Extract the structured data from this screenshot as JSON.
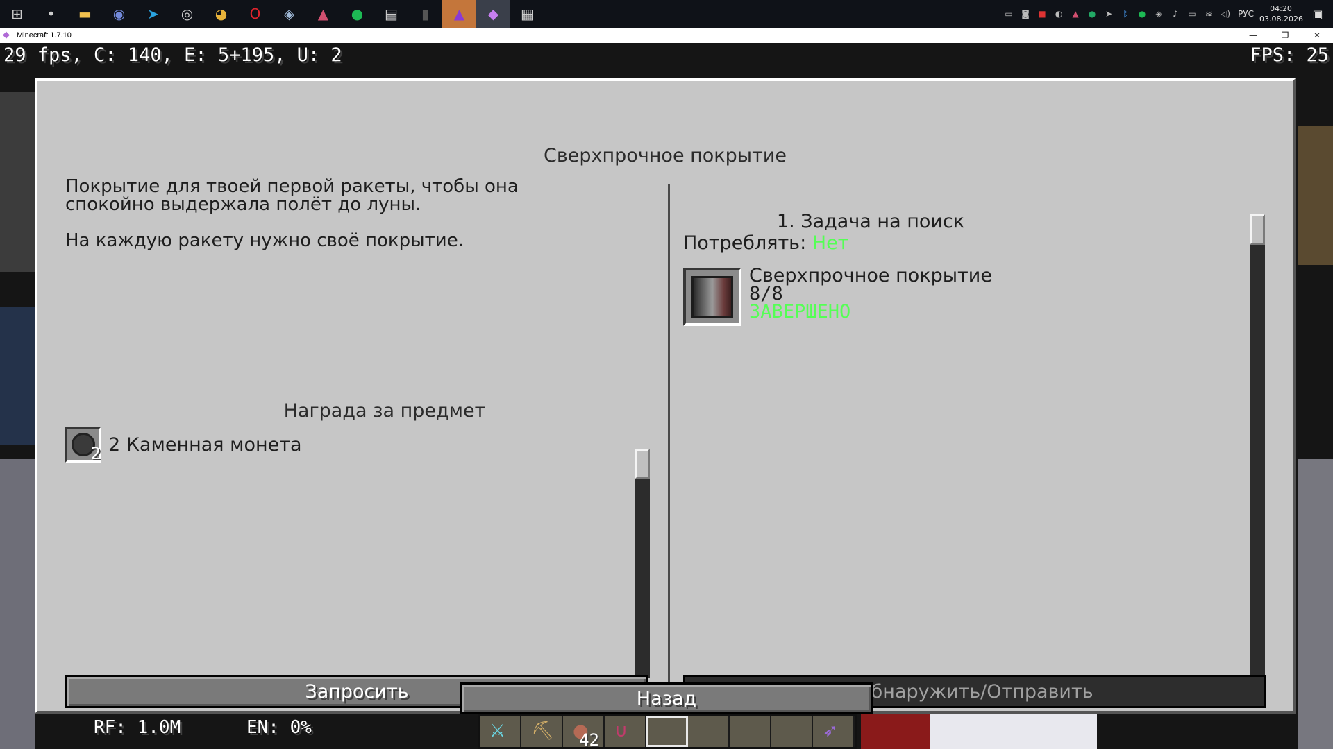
{
  "taskbar": {
    "icons": [
      {
        "name": "windows-start-icon",
        "glyph": "⊞"
      },
      {
        "name": "unknown-app-icon",
        "glyph": "•"
      },
      {
        "name": "file-explorer-icon",
        "glyph": "▬"
      },
      {
        "name": "discord-icon",
        "glyph": "◉"
      },
      {
        "name": "telegram-icon",
        "glyph": "➤"
      },
      {
        "name": "obs-icon",
        "glyph": "◎"
      },
      {
        "name": "chrome-icon",
        "glyph": "◕"
      },
      {
        "name": "opera-icon",
        "glyph": "O"
      },
      {
        "name": "steam-icon",
        "glyph": "◈"
      },
      {
        "name": "launcher-icon",
        "glyph": "▲"
      },
      {
        "name": "spotify-icon",
        "glyph": "●"
      },
      {
        "name": "app-window-icon",
        "glyph": "▤"
      },
      {
        "name": "mouse-app-icon",
        "glyph": "▮"
      },
      {
        "name": "minecraft-launcher-icon",
        "glyph": "▲"
      },
      {
        "name": "gem-app-icon",
        "glyph": "◆"
      },
      {
        "name": "calculator-icon",
        "glyph": "▦"
      }
    ],
    "lang": "РУС",
    "time": "04:20",
    "date": "03.08.2026"
  },
  "window": {
    "title": "Minecraft 1.7.10",
    "minimize": "—",
    "restore": "❐",
    "close": "✕"
  },
  "hud": {
    "debug": "29 fps, C: 140, E: 5+195, U: 2",
    "fps": "FPS: 25",
    "rf": "RF: 1.0M",
    "en": "EN: 0%"
  },
  "quest": {
    "title": "Сверхпрочное покрытие",
    "description": "Покрытие для твоей первой ракеты, чтобы она\nспокойно выдержала полёт до луны.\n\nНа каждую ракету нужно своё покрытие.",
    "reward_title": "Награда за предмет",
    "reward": {
      "count": "2",
      "label": "2 Каменная монета"
    },
    "request_button": "Запросить",
    "task_title": "1. Задача на поиск",
    "consume_label": "Потреблять:",
    "consume_value": "Нет",
    "task_item": {
      "name": "Сверхпрочное покрытие",
      "progress": "8/8",
      "status": "ЗАВЕРШЕНО"
    },
    "submit_button": "Обнаружить/Отправить",
    "back_button": "Назад"
  },
  "hotbar": {
    "slots": [
      {
        "item": "diamond-sword",
        "count": ""
      },
      {
        "item": "pickaxe",
        "count": ""
      },
      {
        "item": "food",
        "count": "42"
      },
      {
        "item": "magnet",
        "count": ""
      },
      {
        "item": "empty",
        "count": ""
      },
      {
        "item": "empty",
        "count": ""
      },
      {
        "item": "empty",
        "count": ""
      },
      {
        "item": "empty",
        "count": ""
      },
      {
        "item": "bow",
        "count": ""
      }
    ],
    "selected": 4
  }
}
